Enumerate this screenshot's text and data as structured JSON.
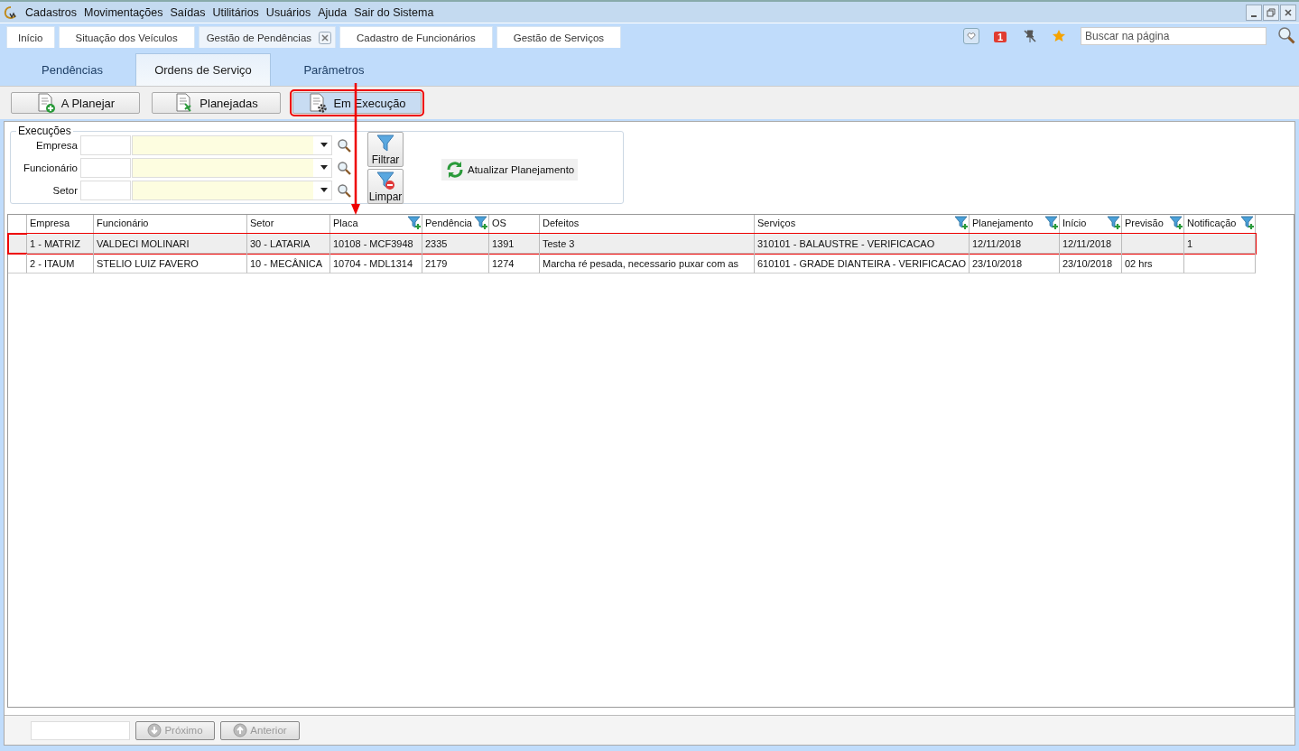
{
  "menu": [
    {
      "label": "Cadastros"
    },
    {
      "label": "Movimentações"
    },
    {
      "label": "Saídas"
    },
    {
      "label": "Utilitários"
    },
    {
      "label": "Usuários"
    },
    {
      "label": "Ajuda"
    },
    {
      "label": "Sair do Sistema"
    }
  ],
  "tabs": [
    {
      "label": "Início",
      "selected": false,
      "closable": false
    },
    {
      "label": "Situação dos Veículos",
      "selected": false,
      "closable": false
    },
    {
      "label": "Gestão de Pendências",
      "selected": true,
      "closable": true
    },
    {
      "label": "Cadastro de Funcionários",
      "selected": false,
      "closable": false
    },
    {
      "label": "Gestão de Serviços",
      "selected": false,
      "closable": false
    }
  ],
  "notification_badge": "1",
  "search": {
    "placeholder": "Buscar na página"
  },
  "subtabs": [
    {
      "label": "Pendências",
      "selected": false
    },
    {
      "label": "Ordens de Serviço",
      "selected": true
    },
    {
      "label": "Parâmetros",
      "selected": false
    }
  ],
  "toolbar": [
    {
      "label": "A Planejar",
      "kind": "add",
      "selected": false,
      "highlighted": false
    },
    {
      "label": "Planejadas",
      "kind": "move",
      "selected": false,
      "highlighted": false
    },
    {
      "label": "Em Execução",
      "kind": "gear",
      "selected": true,
      "highlighted": true
    }
  ],
  "filters": {
    "title": "Execuções",
    "fields": [
      {
        "label": "Empresa"
      },
      {
        "label": "Funcionário"
      },
      {
        "label": "Setor"
      }
    ],
    "buttons": [
      {
        "label": "Filtrar",
        "kind": "filter"
      },
      {
        "label": "Limpar",
        "kind": "clear"
      }
    ],
    "refresh_button": "Atualizar Planejamento"
  },
  "table": {
    "columns": [
      {
        "label": "Empresa",
        "filterable": false
      },
      {
        "label": "Funcionário",
        "filterable": false
      },
      {
        "label": "Setor",
        "filterable": false
      },
      {
        "label": "Placa",
        "filterable": true
      },
      {
        "label": "Pendência",
        "filterable": true
      },
      {
        "label": "OS",
        "filterable": false
      },
      {
        "label": "Defeitos",
        "filterable": false
      },
      {
        "label": "Serviços",
        "filterable": true
      },
      {
        "label": "Planejamento",
        "filterable": true
      },
      {
        "label": "Início",
        "filterable": true
      },
      {
        "label": "Previsão",
        "filterable": true
      },
      {
        "label": "Notificação",
        "filterable": true
      }
    ],
    "rows": [
      {
        "selected": true,
        "highlighted": true,
        "cells": [
          "1 - MATRIZ",
          "VALDECI MOLINARI",
          "30 - LATARIA",
          "10108 - MCF3948",
          "2335",
          "1391",
          "Teste 3",
          "310101 - BALAUSTRE - VERIFICACAO",
          "12/11/2018",
          "12/11/2018",
          "",
          "1"
        ]
      },
      {
        "selected": false,
        "highlighted": false,
        "cells": [
          "2 - ITAUM",
          "STELIO LUIZ FAVERO",
          "10 - MECÂNICA",
          "10704 - MDL1314",
          "2179",
          "1274",
          "Marcha ré pesada, necessario puxar com as",
          "610101 - GRADE DIANTEIRA - VERIFICACAO",
          "23/10/2018",
          "23/10/2018",
          "02 hrs",
          ""
        ]
      }
    ]
  },
  "pager": {
    "buttons": [
      {
        "label": "Próximo",
        "kind": "down",
        "disabled": true
      },
      {
        "label": "Anterior",
        "kind": "up",
        "disabled": true
      }
    ]
  }
}
